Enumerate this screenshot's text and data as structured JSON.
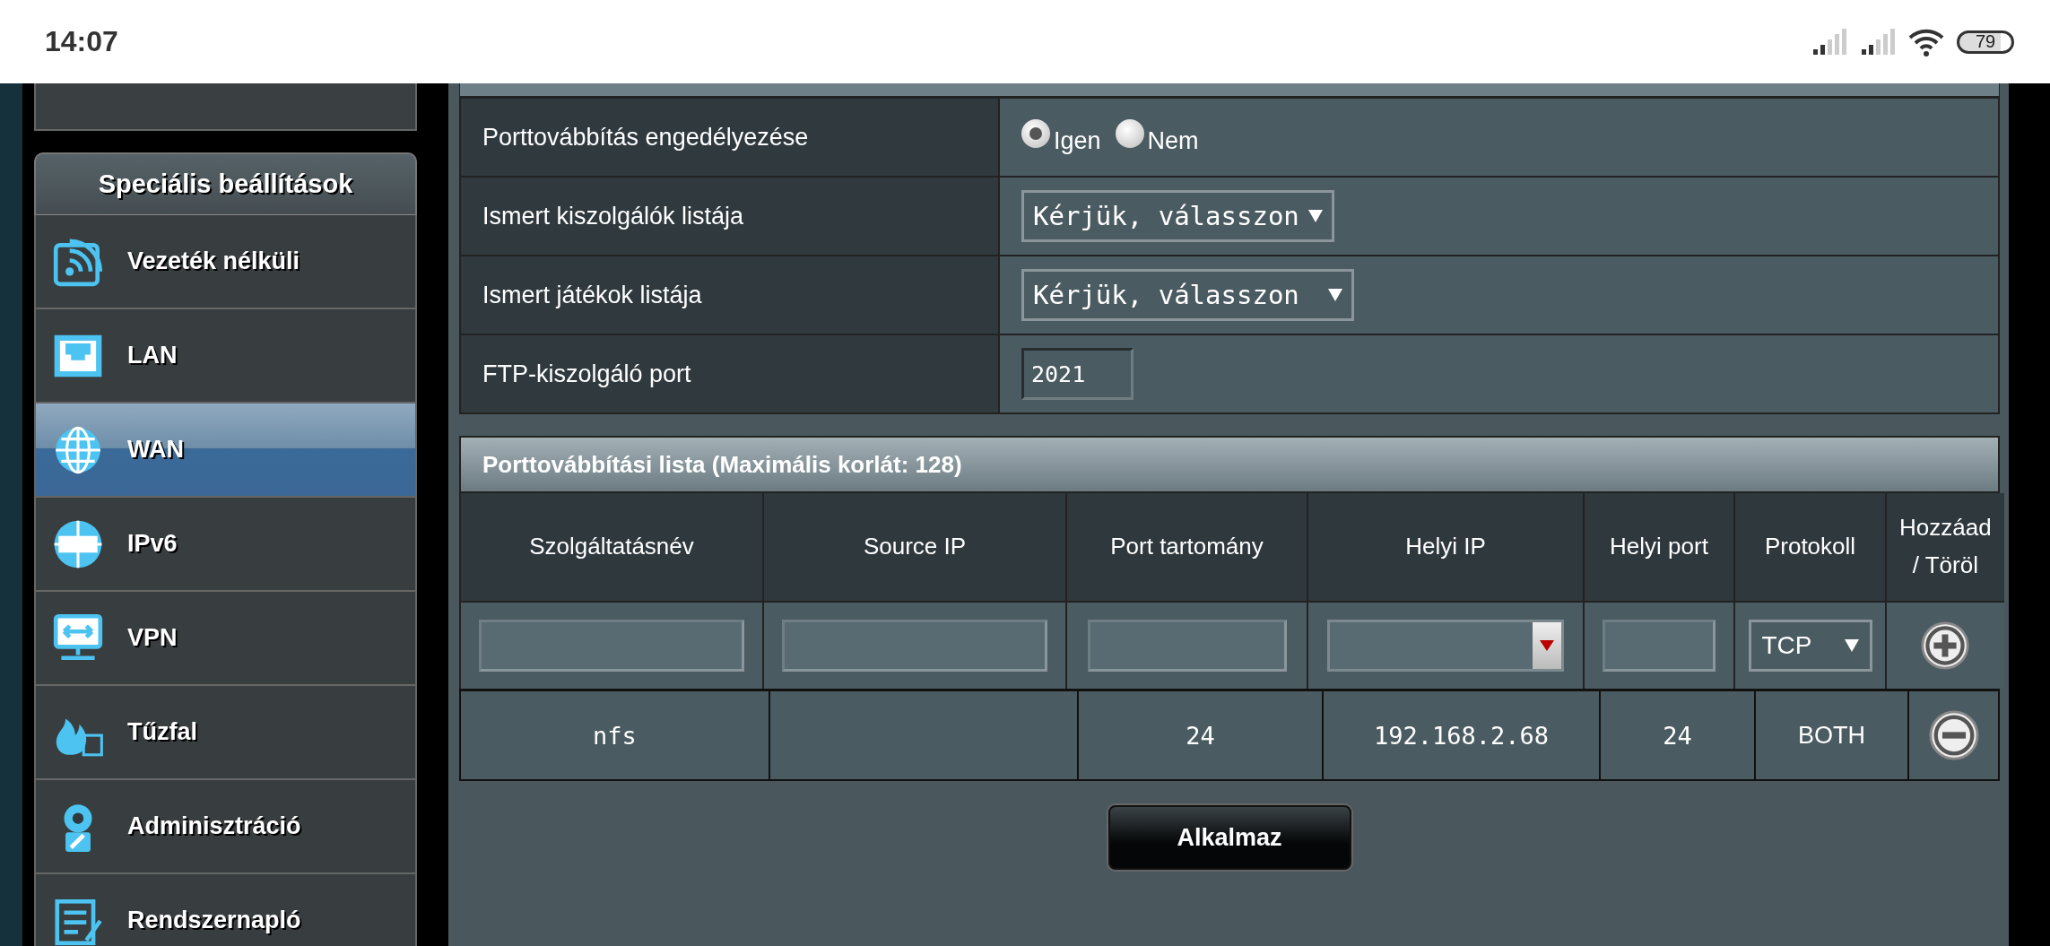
{
  "status_bar": {
    "time": "14:07",
    "battery": "79"
  },
  "sidebar": {
    "section_title": "Speciális beállítások",
    "items": [
      {
        "label": "Vezeték nélküli",
        "selected": false
      },
      {
        "label": "LAN",
        "selected": false
      },
      {
        "label": "WAN",
        "selected": true
      },
      {
        "label": "IPv6",
        "selected": false
      },
      {
        "label": "VPN",
        "selected": false
      },
      {
        "label": "Tűzfal",
        "selected": false
      },
      {
        "label": "Adminisztráció",
        "selected": false
      },
      {
        "label": "Rendszernapló",
        "selected": false
      }
    ]
  },
  "settings": [
    {
      "kind": "radio",
      "label": "Porttovábbítás engedélyezése",
      "options": [
        {
          "label": "Igen",
          "selected": true
        },
        {
          "label": "Nem",
          "selected": false
        }
      ]
    },
    {
      "kind": "select",
      "label": "Ismert kiszolgálók listája",
      "value": "Kérjük, válasszon"
    },
    {
      "kind": "select",
      "label": "Ismert játékok listája",
      "value": "Kérjük, válasszon"
    },
    {
      "kind": "text",
      "label": "FTP-kiszolgáló port",
      "value": "2021"
    }
  ],
  "forward_list": {
    "title": "Porttovábbítási lista (Maximális korlát: 128)",
    "columns": [
      "Szolgáltatásnév",
      "Source IP",
      "Port tartomány",
      "Helyi IP",
      "Helyi port",
      "Protokoll",
      "Hozzáad / Töröl"
    ],
    "input_row": {
      "protocol": "TCP"
    },
    "rows": [
      {
        "service": "nfs",
        "port_range": "24",
        "local_ip": "192.168.2.68",
        "local_port": "24",
        "protocol": "BOTH"
      }
    ]
  },
  "apply_button": "Alkalmaz"
}
